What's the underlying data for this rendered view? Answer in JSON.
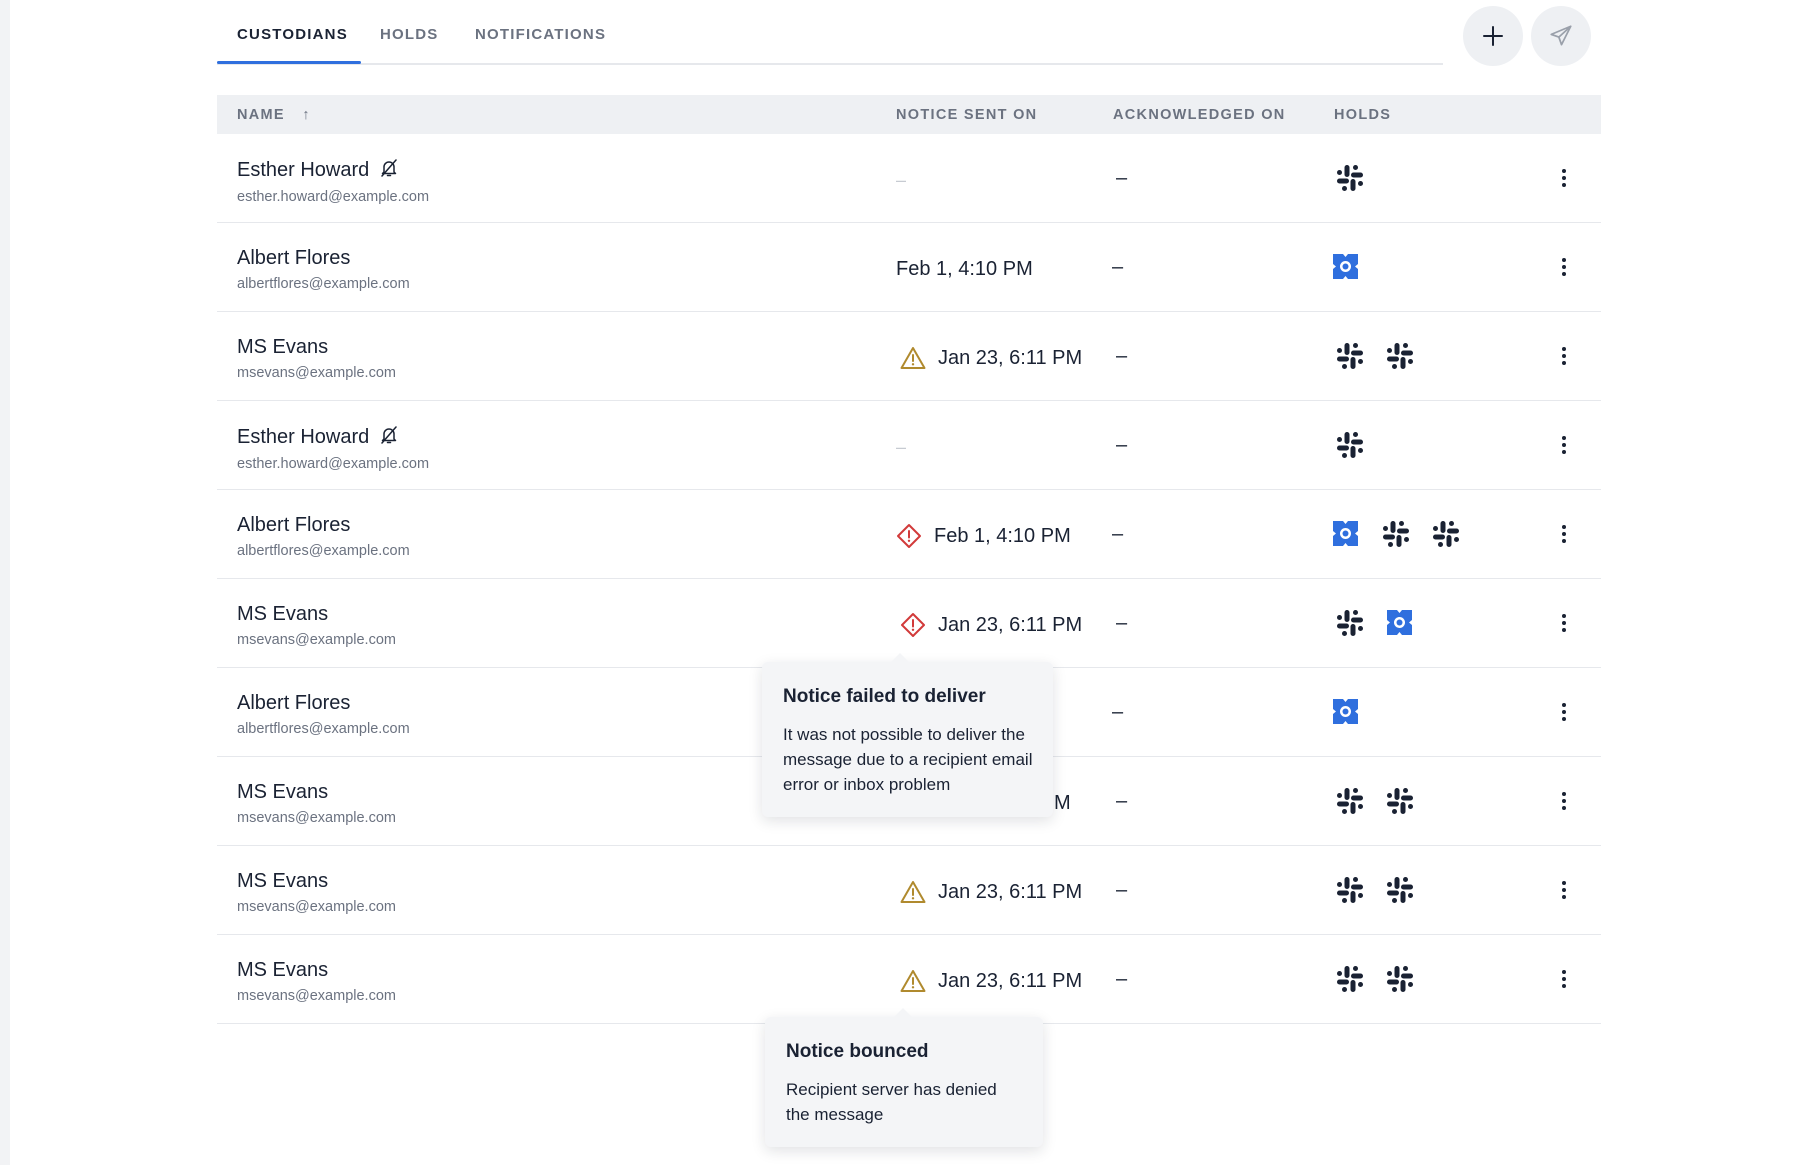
{
  "tabs": [
    "CUSTODIANS",
    "HOLDS",
    "NOTIFICATIONS"
  ],
  "active_tab": "CUSTODIANS",
  "actions": {
    "add_icon": "plus-icon",
    "send_icon": "paper-plane-icon"
  },
  "columns": {
    "name": "NAME",
    "name_sort": "↑",
    "notice_sent_on": "NOTICE SENT ON",
    "acknowledged_on": "ACKNOWLEDGED ON",
    "holds": "HOLDS"
  },
  "rows": [
    {
      "name": "Esther Howard",
      "email": "esther.howard@example.com",
      "muted": true,
      "status": "none",
      "sent": "–",
      "ack": "–",
      "ack_muted": true,
      "holds": [
        "slack"
      ]
    },
    {
      "name": "Albert Flores",
      "email": "albertflores@example.com",
      "muted": false,
      "status": "ok",
      "sent": "Feb 1, 4:10 PM",
      "ack": "–",
      "ack_muted": false,
      "holds": [
        "ms"
      ]
    },
    {
      "name": "MS Evans",
      "email": "msevans@example.com",
      "muted": false,
      "status": "warning",
      "sent": "Jan 23, 6:11 PM",
      "ack": "–",
      "ack_muted": false,
      "holds": [
        "slack",
        "slack"
      ]
    },
    {
      "name": "Esther Howard",
      "email": "esther.howard@example.com",
      "muted": true,
      "status": "none",
      "sent": "–",
      "ack": "–",
      "ack_muted": true,
      "holds": [
        "slack"
      ]
    },
    {
      "name": "Albert Flores",
      "email": "albertflores@example.com",
      "muted": false,
      "status": "error",
      "sent": "Feb 1, 4:10 PM",
      "ack": "–",
      "ack_muted": false,
      "holds": [
        "ms",
        "slack",
        "slack"
      ]
    },
    {
      "name": "MS Evans",
      "email": "msevans@example.com",
      "muted": false,
      "status": "error",
      "sent": "Jan 23, 6:11 PM",
      "ack": "–",
      "ack_muted": false,
      "holds": [
        "slack",
        "ms"
      ]
    },
    {
      "name": "Albert Flores",
      "email": "albertflores@example.com",
      "muted": false,
      "status": "hidden",
      "sent": "",
      "ack": "–",
      "ack_muted": false,
      "holds": [
        "ms"
      ]
    },
    {
      "name": "MS Evans",
      "email": "msevans@example.com",
      "muted": false,
      "status": "hidden",
      "sent": "M",
      "ack": "–",
      "ack_muted": false,
      "holds": [
        "slack",
        "slack"
      ]
    },
    {
      "name": "MS Evans",
      "email": "msevans@example.com",
      "muted": false,
      "status": "warning",
      "sent": "Jan 23, 6:11 PM",
      "ack": "–",
      "ack_muted": false,
      "holds": [
        "slack",
        "slack"
      ]
    },
    {
      "name": "MS Evans",
      "email": "msevans@example.com",
      "muted": false,
      "status": "warning",
      "sent": "Jan 23, 6:11 PM",
      "ack": "–",
      "ack_muted": false,
      "holds": [
        "slack",
        "slack"
      ]
    }
  ],
  "tooltips": {
    "failed": {
      "title": "Notice failed to deliver",
      "body": "It was not possible to deliver the message due to a recipient email error or inbox problem"
    },
    "bounced": {
      "title": "Notice bounced",
      "body": "Recipient server has denied the message"
    }
  },
  "colors": {
    "accent": "#2f6fde",
    "warning": "#b08a2e",
    "error": "#d23a3a",
    "ms_hold": "#2f6fde",
    "slack_hold": "#1a2233"
  }
}
